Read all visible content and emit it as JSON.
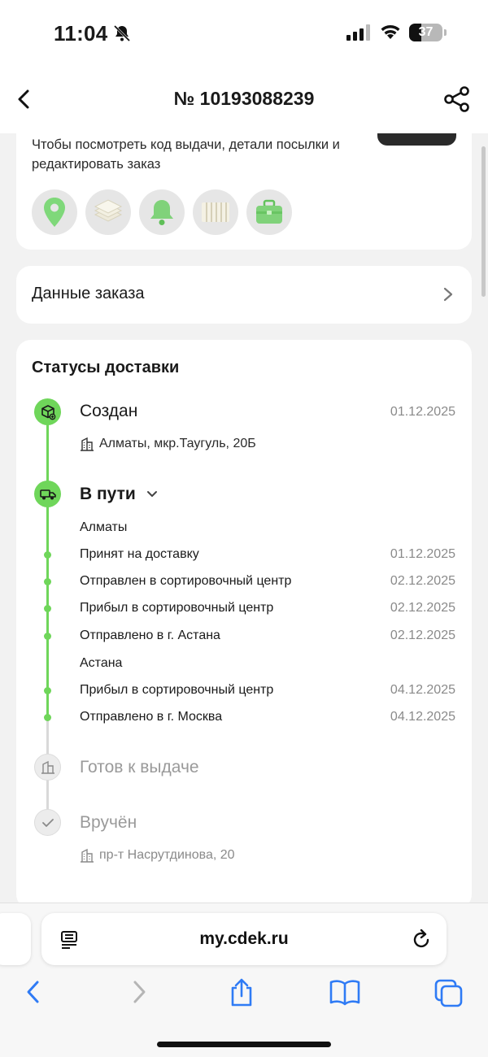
{
  "status_bar": {
    "time": "11:04",
    "battery": "37"
  },
  "header": {
    "title": "№ 10193088239"
  },
  "info_card": {
    "hint": "Чтобы посмотреть код выдачи, детали посылки и редактировать заказ",
    "icons": [
      "location-pin-icon",
      "document-stack-icon",
      "bell-icon",
      "barcode-icon",
      "briefcase-icon"
    ]
  },
  "order_card": {
    "label": "Данные заказа"
  },
  "statuses": {
    "title": "Статусы доставки",
    "created": {
      "label": "Создан",
      "date": "01.12.2025",
      "address": "Алматы, мкр.Таугуль, 20Б"
    },
    "in_transit": {
      "label": "В пути",
      "city1": "Алматы",
      "city2": "Астана",
      "events": [
        {
          "text": "Принят на доставку",
          "date": "01.12.2025"
        },
        {
          "text": "Отправлен в сортировочный центр",
          "date": "02.12.2025"
        },
        {
          "text": "Прибыл в сортировочный центр",
          "date": "02.12.2025"
        },
        {
          "text": "Отправлено в г. Астана",
          "date": "02.12.2025"
        },
        {
          "text": "Прибыл в сортировочный центр",
          "date": "04.12.2025"
        },
        {
          "text": "Отправлено в г. Москва",
          "date": "04.12.2025"
        }
      ]
    },
    "ready": {
      "label": "Готов к выдаче"
    },
    "delivered": {
      "label": "Вручён",
      "address": "пр-т Насрутдинова, 20"
    }
  },
  "browser": {
    "url": "my.cdek.ru"
  },
  "colors": {
    "accent_green": "#6fd65a",
    "muted_grey": "#9a9a9a"
  }
}
